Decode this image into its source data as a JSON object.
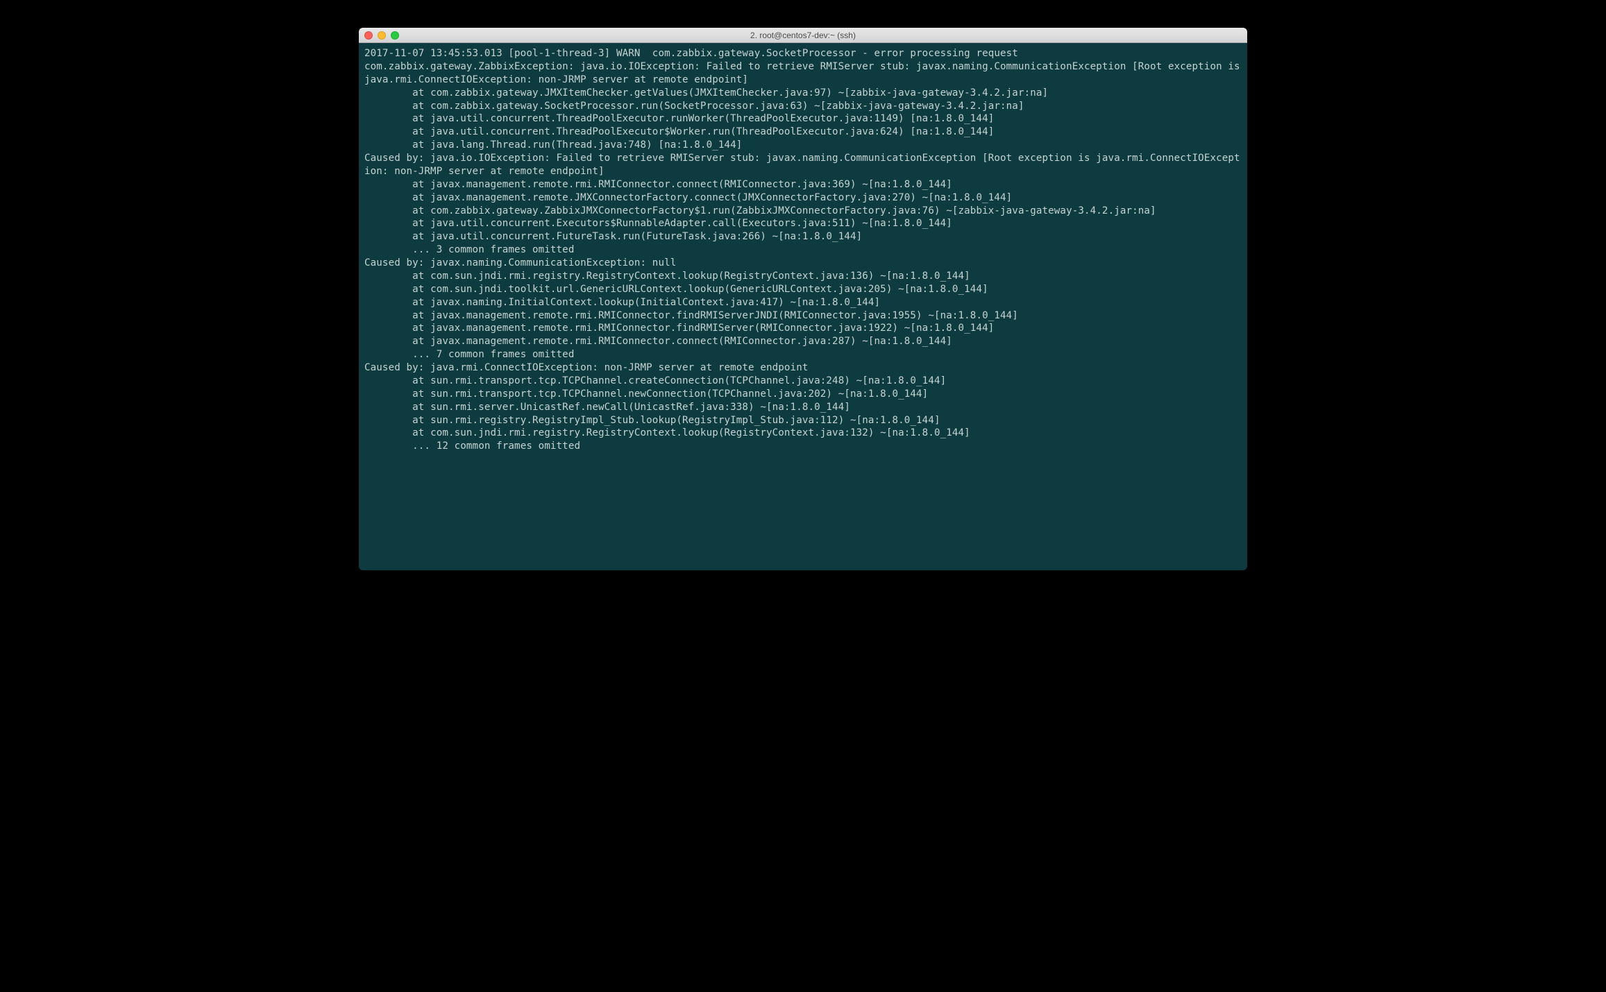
{
  "window": {
    "title": "2. root@centos7-dev:~ (ssh)"
  },
  "terminal": {
    "lines": [
      "2017-11-07 13:45:53.013 [pool-1-thread-3] WARN  com.zabbix.gateway.SocketProcessor - error processing request",
      "com.zabbix.gateway.ZabbixException: java.io.IOException: Failed to retrieve RMIServer stub: javax.naming.CommunicationException [Root exception is java.rmi.ConnectIOException: non-JRMP server at remote endpoint]",
      "        at com.zabbix.gateway.JMXItemChecker.getValues(JMXItemChecker.java:97) ~[zabbix-java-gateway-3.4.2.jar:na]",
      "        at com.zabbix.gateway.SocketProcessor.run(SocketProcessor.java:63) ~[zabbix-java-gateway-3.4.2.jar:na]",
      "        at java.util.concurrent.ThreadPoolExecutor.runWorker(ThreadPoolExecutor.java:1149) [na:1.8.0_144]",
      "        at java.util.concurrent.ThreadPoolExecutor$Worker.run(ThreadPoolExecutor.java:624) [na:1.8.0_144]",
      "        at java.lang.Thread.run(Thread.java:748) [na:1.8.0_144]",
      "Caused by: java.io.IOException: Failed to retrieve RMIServer stub: javax.naming.CommunicationException [Root exception is java.rmi.ConnectIOException: non-JRMP server at remote endpoint]",
      "        at javax.management.remote.rmi.RMIConnector.connect(RMIConnector.java:369) ~[na:1.8.0_144]",
      "        at javax.management.remote.JMXConnectorFactory.connect(JMXConnectorFactory.java:270) ~[na:1.8.0_144]",
      "        at com.zabbix.gateway.ZabbixJMXConnectorFactory$1.run(ZabbixJMXConnectorFactory.java:76) ~[zabbix-java-gateway-3.4.2.jar:na]",
      "        at java.util.concurrent.Executors$RunnableAdapter.call(Executors.java:511) ~[na:1.8.0_144]",
      "        at java.util.concurrent.FutureTask.run(FutureTask.java:266) ~[na:1.8.0_144]",
      "        ... 3 common frames omitted",
      "Caused by: javax.naming.CommunicationException: null",
      "        at com.sun.jndi.rmi.registry.RegistryContext.lookup(RegistryContext.java:136) ~[na:1.8.0_144]",
      "        at com.sun.jndi.toolkit.url.GenericURLContext.lookup(GenericURLContext.java:205) ~[na:1.8.0_144]",
      "        at javax.naming.InitialContext.lookup(InitialContext.java:417) ~[na:1.8.0_144]",
      "        at javax.management.remote.rmi.RMIConnector.findRMIServerJNDI(RMIConnector.java:1955) ~[na:1.8.0_144]",
      "        at javax.management.remote.rmi.RMIConnector.findRMIServer(RMIConnector.java:1922) ~[na:1.8.0_144]",
      "        at javax.management.remote.rmi.RMIConnector.connect(RMIConnector.java:287) ~[na:1.8.0_144]",
      "        ... 7 common frames omitted",
      "Caused by: java.rmi.ConnectIOException: non-JRMP server at remote endpoint",
      "        at sun.rmi.transport.tcp.TCPChannel.createConnection(TCPChannel.java:248) ~[na:1.8.0_144]",
      "        at sun.rmi.transport.tcp.TCPChannel.newConnection(TCPChannel.java:202) ~[na:1.8.0_144]",
      "        at sun.rmi.server.UnicastRef.newCall(UnicastRef.java:338) ~[na:1.8.0_144]",
      "        at sun.rmi.registry.RegistryImpl_Stub.lookup(RegistryImpl_Stub.java:112) ~[na:1.8.0_144]",
      "        at com.sun.jndi.rmi.registry.RegistryContext.lookup(RegistryContext.java:132) ~[na:1.8.0_144]",
      "        ... 12 common frames omitted"
    ]
  }
}
